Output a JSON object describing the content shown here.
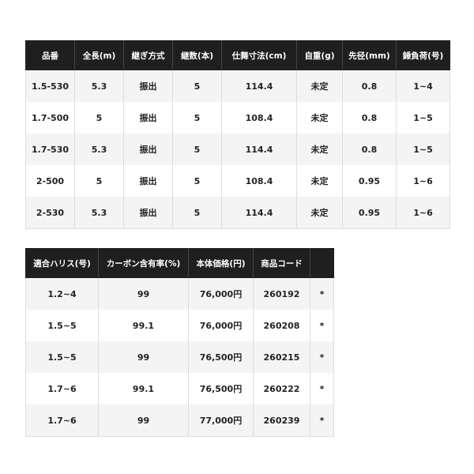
{
  "table1": {
    "headers": [
      "品番",
      "全長(m)",
      "継ぎ方式",
      "継数(本)",
      "仕舞寸法(cm)",
      "自重(g)",
      "先径(mm)",
      "錘負荷(号)"
    ],
    "rows": [
      [
        "1.5-530",
        "5.3",
        "振出",
        "5",
        "114.4",
        "未定",
        "0.8",
        "1~4"
      ],
      [
        "1.7-500",
        "5",
        "振出",
        "5",
        "108.4",
        "未定",
        "0.8",
        "1~5"
      ],
      [
        "1.7-530",
        "5.3",
        "振出",
        "5",
        "114.4",
        "未定",
        "0.8",
        "1~5"
      ],
      [
        "2-500",
        "5",
        "振出",
        "5",
        "108.4",
        "未定",
        "0.95",
        "1~6"
      ],
      [
        "2-530",
        "5.3",
        "振出",
        "5",
        "114.4",
        "未定",
        "0.95",
        "1~6"
      ]
    ]
  },
  "table2": {
    "headers": [
      "適合ハリス(号)",
      "カーボン含有率(%)",
      "本体価格(円)",
      "商品コード",
      ""
    ],
    "rows": [
      [
        "1.2~4",
        "99",
        "76,000円",
        "260192",
        "*"
      ],
      [
        "1.5~5",
        "99.1",
        "76,000円",
        "260208",
        "*"
      ],
      [
        "1.5~5",
        "99",
        "76,500円",
        "260215",
        "*"
      ],
      [
        "1.7~6",
        "99.1",
        "76,500円",
        "260222",
        "*"
      ],
      [
        "1.7~6",
        "99",
        "77,000円",
        "260239",
        "*"
      ]
    ]
  }
}
